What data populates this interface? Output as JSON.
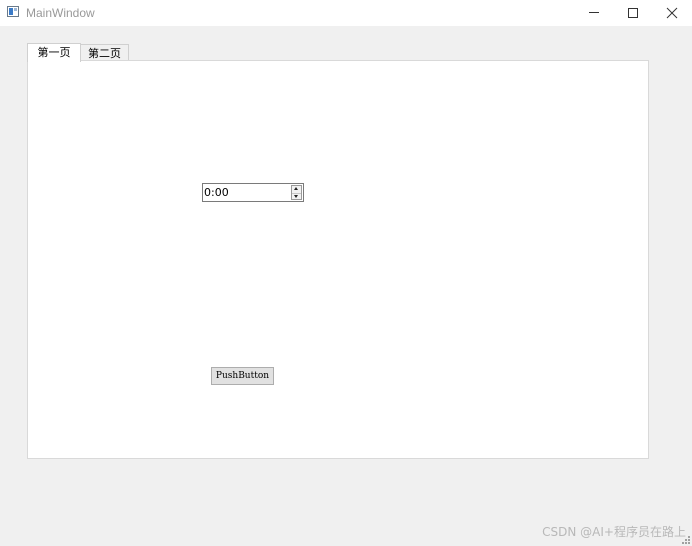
{
  "window": {
    "title": "MainWindow",
    "icon": "app-window-icon",
    "controls": [
      "minimize-icon",
      "maximize-icon",
      "close-icon"
    ]
  },
  "tabs": [
    {
      "label": "第一页",
      "selected": true
    },
    {
      "label": "第二页",
      "selected": false
    }
  ],
  "page1": {
    "time_edit": {
      "value": "0:00"
    },
    "push_button": {
      "label": "PushButton"
    }
  },
  "watermark": "CSDN @AI+程序员在路上"
}
